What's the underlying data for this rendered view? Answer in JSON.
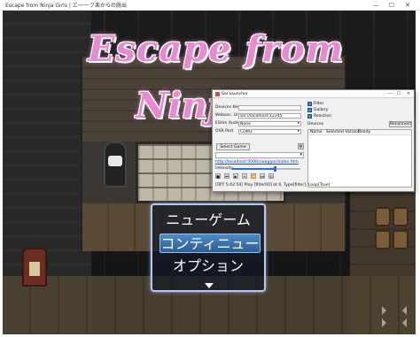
{
  "window": {
    "title": "Escape from Ninja Girls | エ──ーク楽からの脱出",
    "controls": [
      "—",
      "☐",
      "✕"
    ]
  },
  "game": {
    "title_line1": "Escape from",
    "title_line2": "Ninja",
    "menu": {
      "options": [
        "ニューゲーム",
        "コンティニュー",
        "オプション"
      ],
      "selected_index": 1
    }
  },
  "launcher": {
    "title": "Sal Launcher",
    "controls": [
      "—",
      "☐",
      "✕"
    ],
    "devices_keys_label": "Devices Keys",
    "devices_keys_value": "",
    "websocket_label": "Websoc. Url",
    "websocket_value": "ws://localhost:12345",
    "estim_audio_label": "EStim Audio",
    "estim_audio_value": "None",
    "osr_port_label": "OSR Port",
    "osr_port_value": "COM3",
    "checkboxes": [
      {
        "label": "Filter",
        "checked": true
      },
      {
        "label": "Gallery",
        "checked": true
      },
      {
        "label": "Reaction",
        "checked": true
      }
    ],
    "devices_label": "Devices",
    "reconnect_label": "Reconnect",
    "table_headers": [
      "Name",
      "Selected Variant",
      "Ready"
    ],
    "select_game_label": "Select Game",
    "link": "http://localhost:5000/swagger/index.htm",
    "intensity_label": "Intensity",
    "intensity_value": 0.62,
    "player_icons": [
      "stop-icon",
      "prev-icon",
      "play-icon",
      "pause-icon",
      "rewind-icon",
      "next-icon",
      "loop-icon"
    ],
    "status_text": "[대부 5:42:54] Play [filter00] at 0, Type[filter], Loop[True]"
  }
}
